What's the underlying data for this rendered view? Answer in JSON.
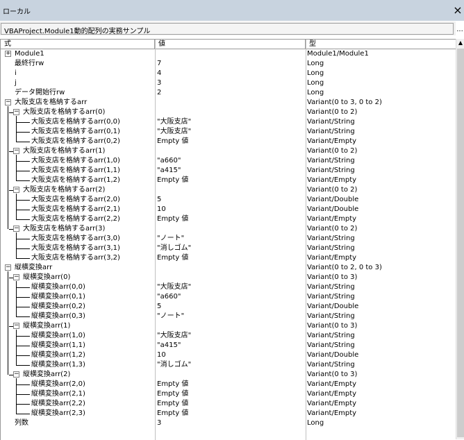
{
  "window": {
    "title": "ローカル",
    "close_label": "×"
  },
  "context": {
    "label": "VBAProject.Module1動的配列の実務サンプル",
    "ellipsis": "..."
  },
  "columns": {
    "expression": "式",
    "value": "値",
    "type": "型"
  },
  "scrollbar": {
    "up_arrow": "▲"
  },
  "rows": [
    {
      "name": "Module1",
      "value": "",
      "type": "Module1/Module1",
      "level": 0,
      "node": "collapsed"
    },
    {
      "name": "最終行rw",
      "value": "7",
      "type": "Long",
      "level": 1,
      "node": "leaf-plain"
    },
    {
      "name": "i",
      "value": "4",
      "type": "Long",
      "level": 1,
      "node": "leaf-plain"
    },
    {
      "name": "j",
      "value": "3",
      "type": "Long",
      "level": 1,
      "node": "leaf-plain"
    },
    {
      "name": "データ開始行rw",
      "value": "2",
      "type": "Long",
      "level": 1,
      "node": "leaf-plain"
    },
    {
      "name": "大阪支店を格納するarr",
      "value": "",
      "type": "Variant(0 to 3, 0 to 2)",
      "level": 0,
      "node": "expanded"
    },
    {
      "name": "大阪支店を格納するarr(0)",
      "value": "",
      "type": "Variant(0 to 2)",
      "level": 1,
      "node": "expanded"
    },
    {
      "name": "大阪支店を格納するarr(0,0)",
      "value": "\"大阪支店\"",
      "type": "Variant/String",
      "level": 2,
      "node": "leaf"
    },
    {
      "name": "大阪支店を格納するarr(0,1)",
      "value": "\"大阪支店\"",
      "type": "Variant/String",
      "level": 2,
      "node": "leaf"
    },
    {
      "name": "大阪支店を格納するarr(0,2)",
      "value": "Empty 値",
      "type": "Variant/Empty",
      "level": 2,
      "node": "leaf"
    },
    {
      "name": "大阪支店を格納するarr(1)",
      "value": "",
      "type": "Variant(0 to 2)",
      "level": 1,
      "node": "expanded"
    },
    {
      "name": "大阪支店を格納するarr(1,0)",
      "value": "\"a660\"",
      "type": "Variant/String",
      "level": 2,
      "node": "leaf"
    },
    {
      "name": "大阪支店を格納するarr(1,1)",
      "value": "\"a415\"",
      "type": "Variant/String",
      "level": 2,
      "node": "leaf"
    },
    {
      "name": "大阪支店を格納するarr(1,2)",
      "value": "Empty 値",
      "type": "Variant/Empty",
      "level": 2,
      "node": "leaf"
    },
    {
      "name": "大阪支店を格納するarr(2)",
      "value": "",
      "type": "Variant(0 to 2)",
      "level": 1,
      "node": "expanded"
    },
    {
      "name": "大阪支店を格納するarr(2,0)",
      "value": "5",
      "type": "Variant/Double",
      "level": 2,
      "node": "leaf"
    },
    {
      "name": "大阪支店を格納するarr(2,1)",
      "value": "10",
      "type": "Variant/Double",
      "level": 2,
      "node": "leaf"
    },
    {
      "name": "大阪支店を格納するarr(2,2)",
      "value": "Empty 値",
      "type": "Variant/Empty",
      "level": 2,
      "node": "leaf"
    },
    {
      "name": "大阪支店を格納するarr(3)",
      "value": "",
      "type": "Variant(0 to 2)",
      "level": 1,
      "node": "expanded"
    },
    {
      "name": "大阪支店を格納するarr(3,0)",
      "value": "\"ノート\"",
      "type": "Variant/String",
      "level": 2,
      "node": "leaf"
    },
    {
      "name": "大阪支店を格納するarr(3,1)",
      "value": "\"消しゴム\"",
      "type": "Variant/String",
      "level": 2,
      "node": "leaf"
    },
    {
      "name": "大阪支店を格納するarr(3,2)",
      "value": "Empty 値",
      "type": "Variant/Empty",
      "level": 2,
      "node": "leaf"
    },
    {
      "name": "縦横変換arr",
      "value": "",
      "type": "Variant(0 to 2, 0 to 3)",
      "level": 0,
      "node": "expanded"
    },
    {
      "name": "縦横変換arr(0)",
      "value": "",
      "type": "Variant(0 to 3)",
      "level": 1,
      "node": "expanded"
    },
    {
      "name": "縦横変換arr(0,0)",
      "value": "\"大阪支店\"",
      "type": "Variant/String",
      "level": 2,
      "node": "leaf"
    },
    {
      "name": "縦横変換arr(0,1)",
      "value": "\"a660\"",
      "type": "Variant/String",
      "level": 2,
      "node": "leaf"
    },
    {
      "name": "縦横変換arr(0,2)",
      "value": "5",
      "type": "Variant/Double",
      "level": 2,
      "node": "leaf"
    },
    {
      "name": "縦横変換arr(0,3)",
      "value": "\"ノート\"",
      "type": "Variant/String",
      "level": 2,
      "node": "leaf"
    },
    {
      "name": "縦横変換arr(1)",
      "value": "",
      "type": "Variant(0 to 3)",
      "level": 1,
      "node": "expanded"
    },
    {
      "name": "縦横変換arr(1,0)",
      "value": "\"大阪支店\"",
      "type": "Variant/String",
      "level": 2,
      "node": "leaf"
    },
    {
      "name": "縦横変換arr(1,1)",
      "value": "\"a415\"",
      "type": "Variant/String",
      "level": 2,
      "node": "leaf"
    },
    {
      "name": "縦横変換arr(1,2)",
      "value": "10",
      "type": "Variant/Double",
      "level": 2,
      "node": "leaf"
    },
    {
      "name": "縦横変換arr(1,3)",
      "value": "\"消しゴム\"",
      "type": "Variant/String",
      "level": 2,
      "node": "leaf"
    },
    {
      "name": "縦横変換arr(2)",
      "value": "",
      "type": "Variant(0 to 3)",
      "level": 1,
      "node": "expanded"
    },
    {
      "name": "縦横変換arr(2,0)",
      "value": "Empty 値",
      "type": "Variant/Empty",
      "level": 2,
      "node": "leaf"
    },
    {
      "name": "縦横変換arr(2,1)",
      "value": "Empty 値",
      "type": "Variant/Empty",
      "level": 2,
      "node": "leaf"
    },
    {
      "name": "縦横変換arr(2,2)",
      "value": "Empty 値",
      "type": "Variant/Empty",
      "level": 2,
      "node": "leaf"
    },
    {
      "name": "縦横変換arr(2,3)",
      "value": "Empty 値",
      "type": "Variant/Empty",
      "level": 2,
      "node": "leaf"
    },
    {
      "name": "列数",
      "value": "3",
      "type": "Long",
      "level": 1,
      "node": "leaf-plain"
    }
  ]
}
